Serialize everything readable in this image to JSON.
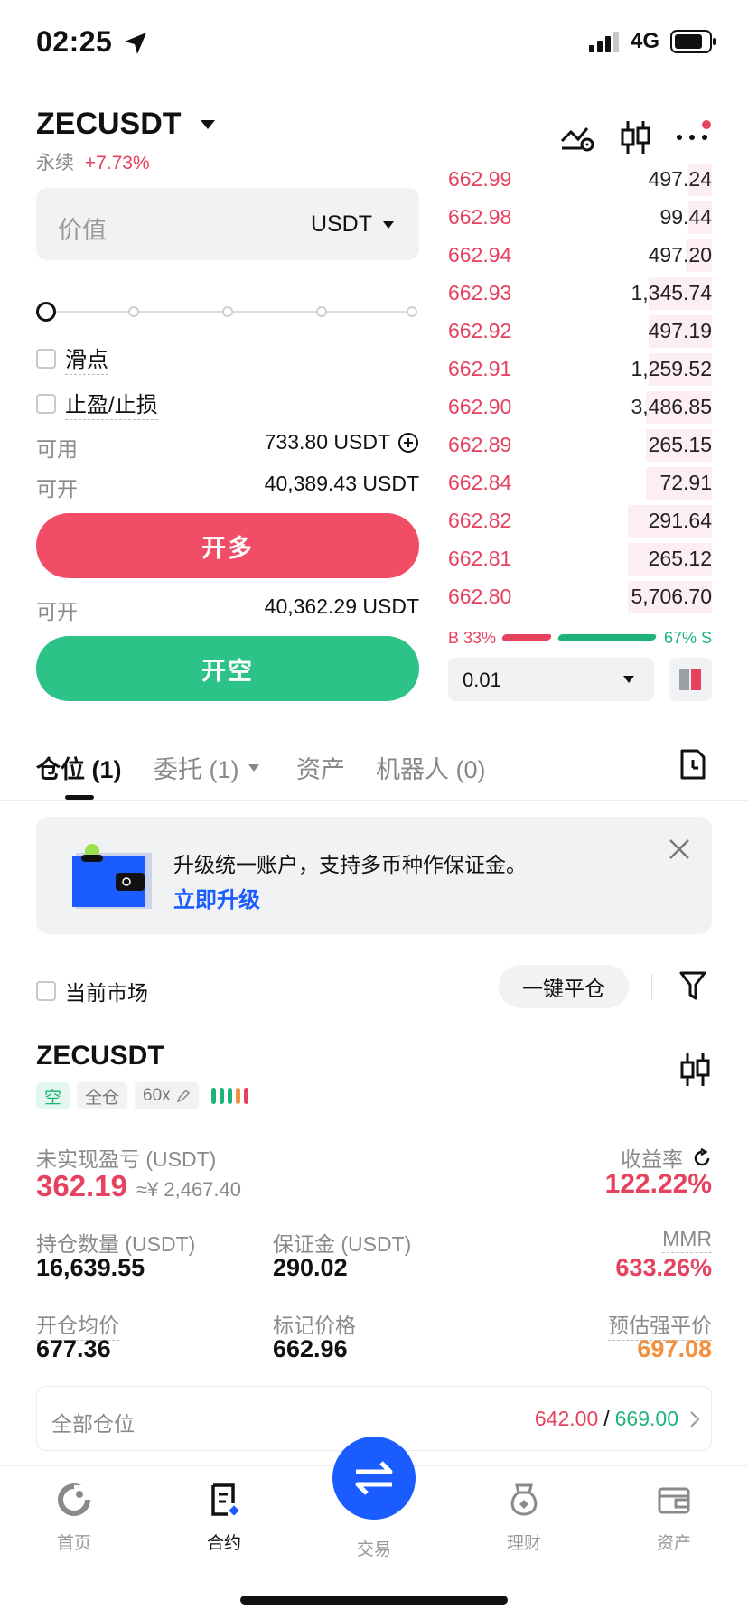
{
  "status_bar": {
    "time": "02:25",
    "network": "4G"
  },
  "header": {
    "symbol": "ZECUSDT",
    "contract_type": "永续",
    "change": "+7.73%"
  },
  "order_form": {
    "value_placeholder": "价值",
    "unit": "USDT",
    "slippage_label": "滑点",
    "tp_sl_label": "止盈/止损",
    "available_label": "可用",
    "available_value": "733.80 USDT",
    "open_long_label": "可开",
    "open_long_value": "40,389.43 USDT",
    "long_button": "开多",
    "open_short_label": "可开",
    "open_short_value": "40,362.29 USDT",
    "short_button": "开空",
    "leverage_slider_fraction": 0
  },
  "order_book": {
    "asks": [
      {
        "price": "662.99",
        "qty": "497.24",
        "depth": 0.09
      },
      {
        "price": "662.98",
        "qty": "99.44",
        "depth": 0.09
      },
      {
        "price": "662.94",
        "qty": "497.20",
        "depth": 0.1
      },
      {
        "price": "662.93",
        "qty": "1,345.74",
        "depth": 0.24
      },
      {
        "price": "662.92",
        "qty": "497.19",
        "depth": 0.24
      },
      {
        "price": "662.91",
        "qty": "1,259.52",
        "depth": 0.24
      },
      {
        "price": "662.90",
        "qty": "3,486.85",
        "depth": 0.25
      },
      {
        "price": "662.89",
        "qty": "265.15",
        "depth": 0.25
      },
      {
        "price": "662.84",
        "qty": "72.91",
        "depth": 0.25
      },
      {
        "price": "662.82",
        "qty": "291.64",
        "depth": 0.32
      },
      {
        "price": "662.81",
        "qty": "265.12",
        "depth": 0.32
      },
      {
        "price": "662.80",
        "qty": "5,706.70",
        "depth": 0.32
      }
    ],
    "buy_ratio_label": "B 33%",
    "sell_ratio_label": "67% S",
    "buy_ratio": 0.33,
    "precision": "0.01"
  },
  "tabs": [
    {
      "label": "仓位 (1)"
    },
    {
      "label": "委托 (1)"
    },
    {
      "label": "资产"
    },
    {
      "label": "机器人 (0)"
    }
  ],
  "banner": {
    "text": "升级统一账户，支持多币种作保证金。",
    "link": "立即升级"
  },
  "filter": {
    "current_market": "当前市场",
    "close_all": "一键平仓"
  },
  "position": {
    "symbol": "ZECUSDT",
    "side": "空",
    "margin_mode": "全仓",
    "leverage": "60x",
    "upnl_label": "未实现盈亏 (USDT)",
    "upnl_value": "362.19",
    "upnl_cny": "≈¥ 2,467.40",
    "roe_label": "收益率",
    "roe_value": "122.22%",
    "size_label": "持仓数量 (USDT)",
    "size_value": "16,639.55",
    "margin_label": "保证金 (USDT)",
    "margin_value": "290.02",
    "mmr_label": "MMR",
    "mmr_value": "633.26%",
    "entry_label": "开仓均价",
    "entry_value": "677.36",
    "mark_label": "标记价格",
    "mark_value": "662.96",
    "liq_label": "预估强平价",
    "liq_value": "697.08",
    "all_positions_label": "全部仓位",
    "tp_value": "642.00",
    "sl_value": "669.00",
    "separator": "/"
  },
  "nav": [
    {
      "label": "首页"
    },
    {
      "label": "合约"
    },
    {
      "label": "交易"
    },
    {
      "label": "理财"
    },
    {
      "label": "资产"
    }
  ],
  "colors": {
    "red": "#e6415f",
    "green": "#1fb37a",
    "blue": "#1a5cff",
    "orange": "#f3903f"
  }
}
